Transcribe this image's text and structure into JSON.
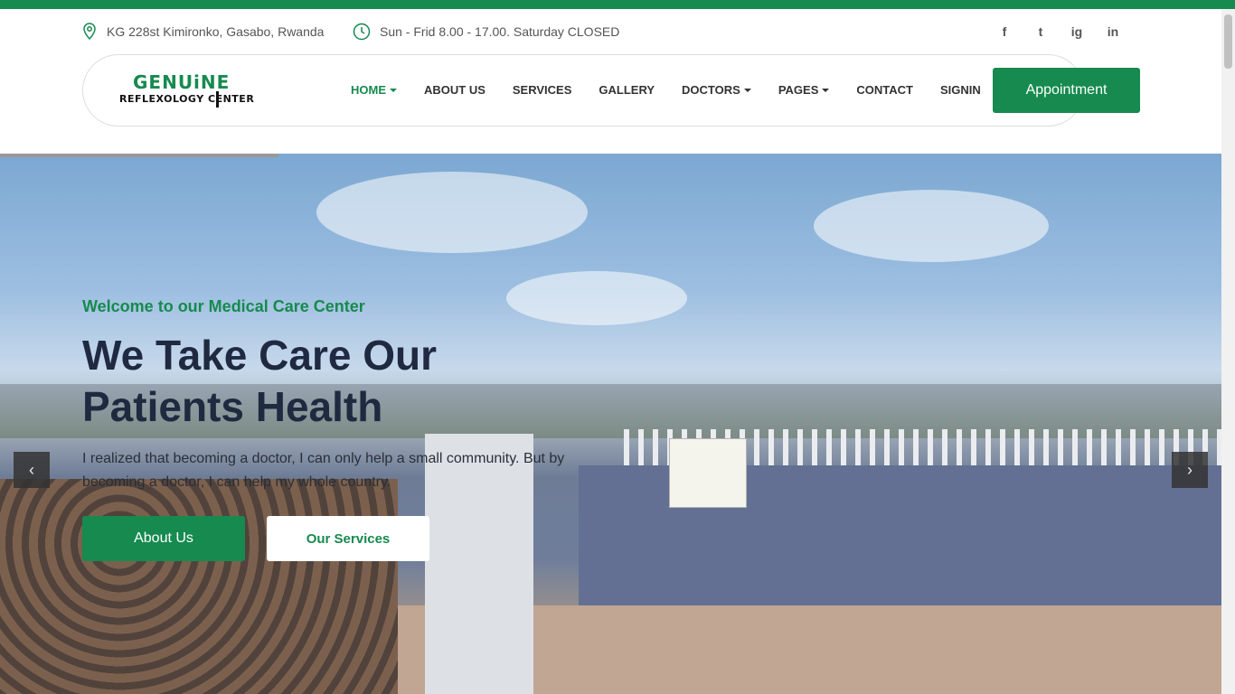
{
  "topbar": {
    "address": "KG 228st Kimironko, Gasabo, Rwanda",
    "hours": "Sun - Frid 8.00 - 17.00. Saturday CLOSED",
    "socials": [
      "f",
      "t",
      "ig",
      "in"
    ]
  },
  "logo": {
    "top": "GENUiNE",
    "bottom": "REFLEXOLOGY  CENTER"
  },
  "nav": {
    "items": [
      {
        "label": "HOME",
        "dropdown": true
      },
      {
        "label": "ABOUT US",
        "dropdown": false
      },
      {
        "label": "SERVICES",
        "dropdown": false
      },
      {
        "label": "GALLERY",
        "dropdown": false
      },
      {
        "label": "DOCTORS",
        "dropdown": true
      },
      {
        "label": "PAGES",
        "dropdown": true
      },
      {
        "label": "CONTACT",
        "dropdown": false
      },
      {
        "label": "SIGNIN",
        "dropdown": false
      }
    ],
    "cta": "Appointment"
  },
  "hero": {
    "subtitle": "Welcome to our Medical Care Center",
    "title": "We Take Care Our Patients Health",
    "text": "I realized that becoming a doctor, I can only help a small community. But by becoming a doctor, I can help my whole country.",
    "btn_primary": "About Us",
    "btn_secondary": "Our Services",
    "prev": "‹",
    "next": "›"
  },
  "colors": {
    "accent": "#168a4f",
    "dark": "#1f2a40"
  }
}
